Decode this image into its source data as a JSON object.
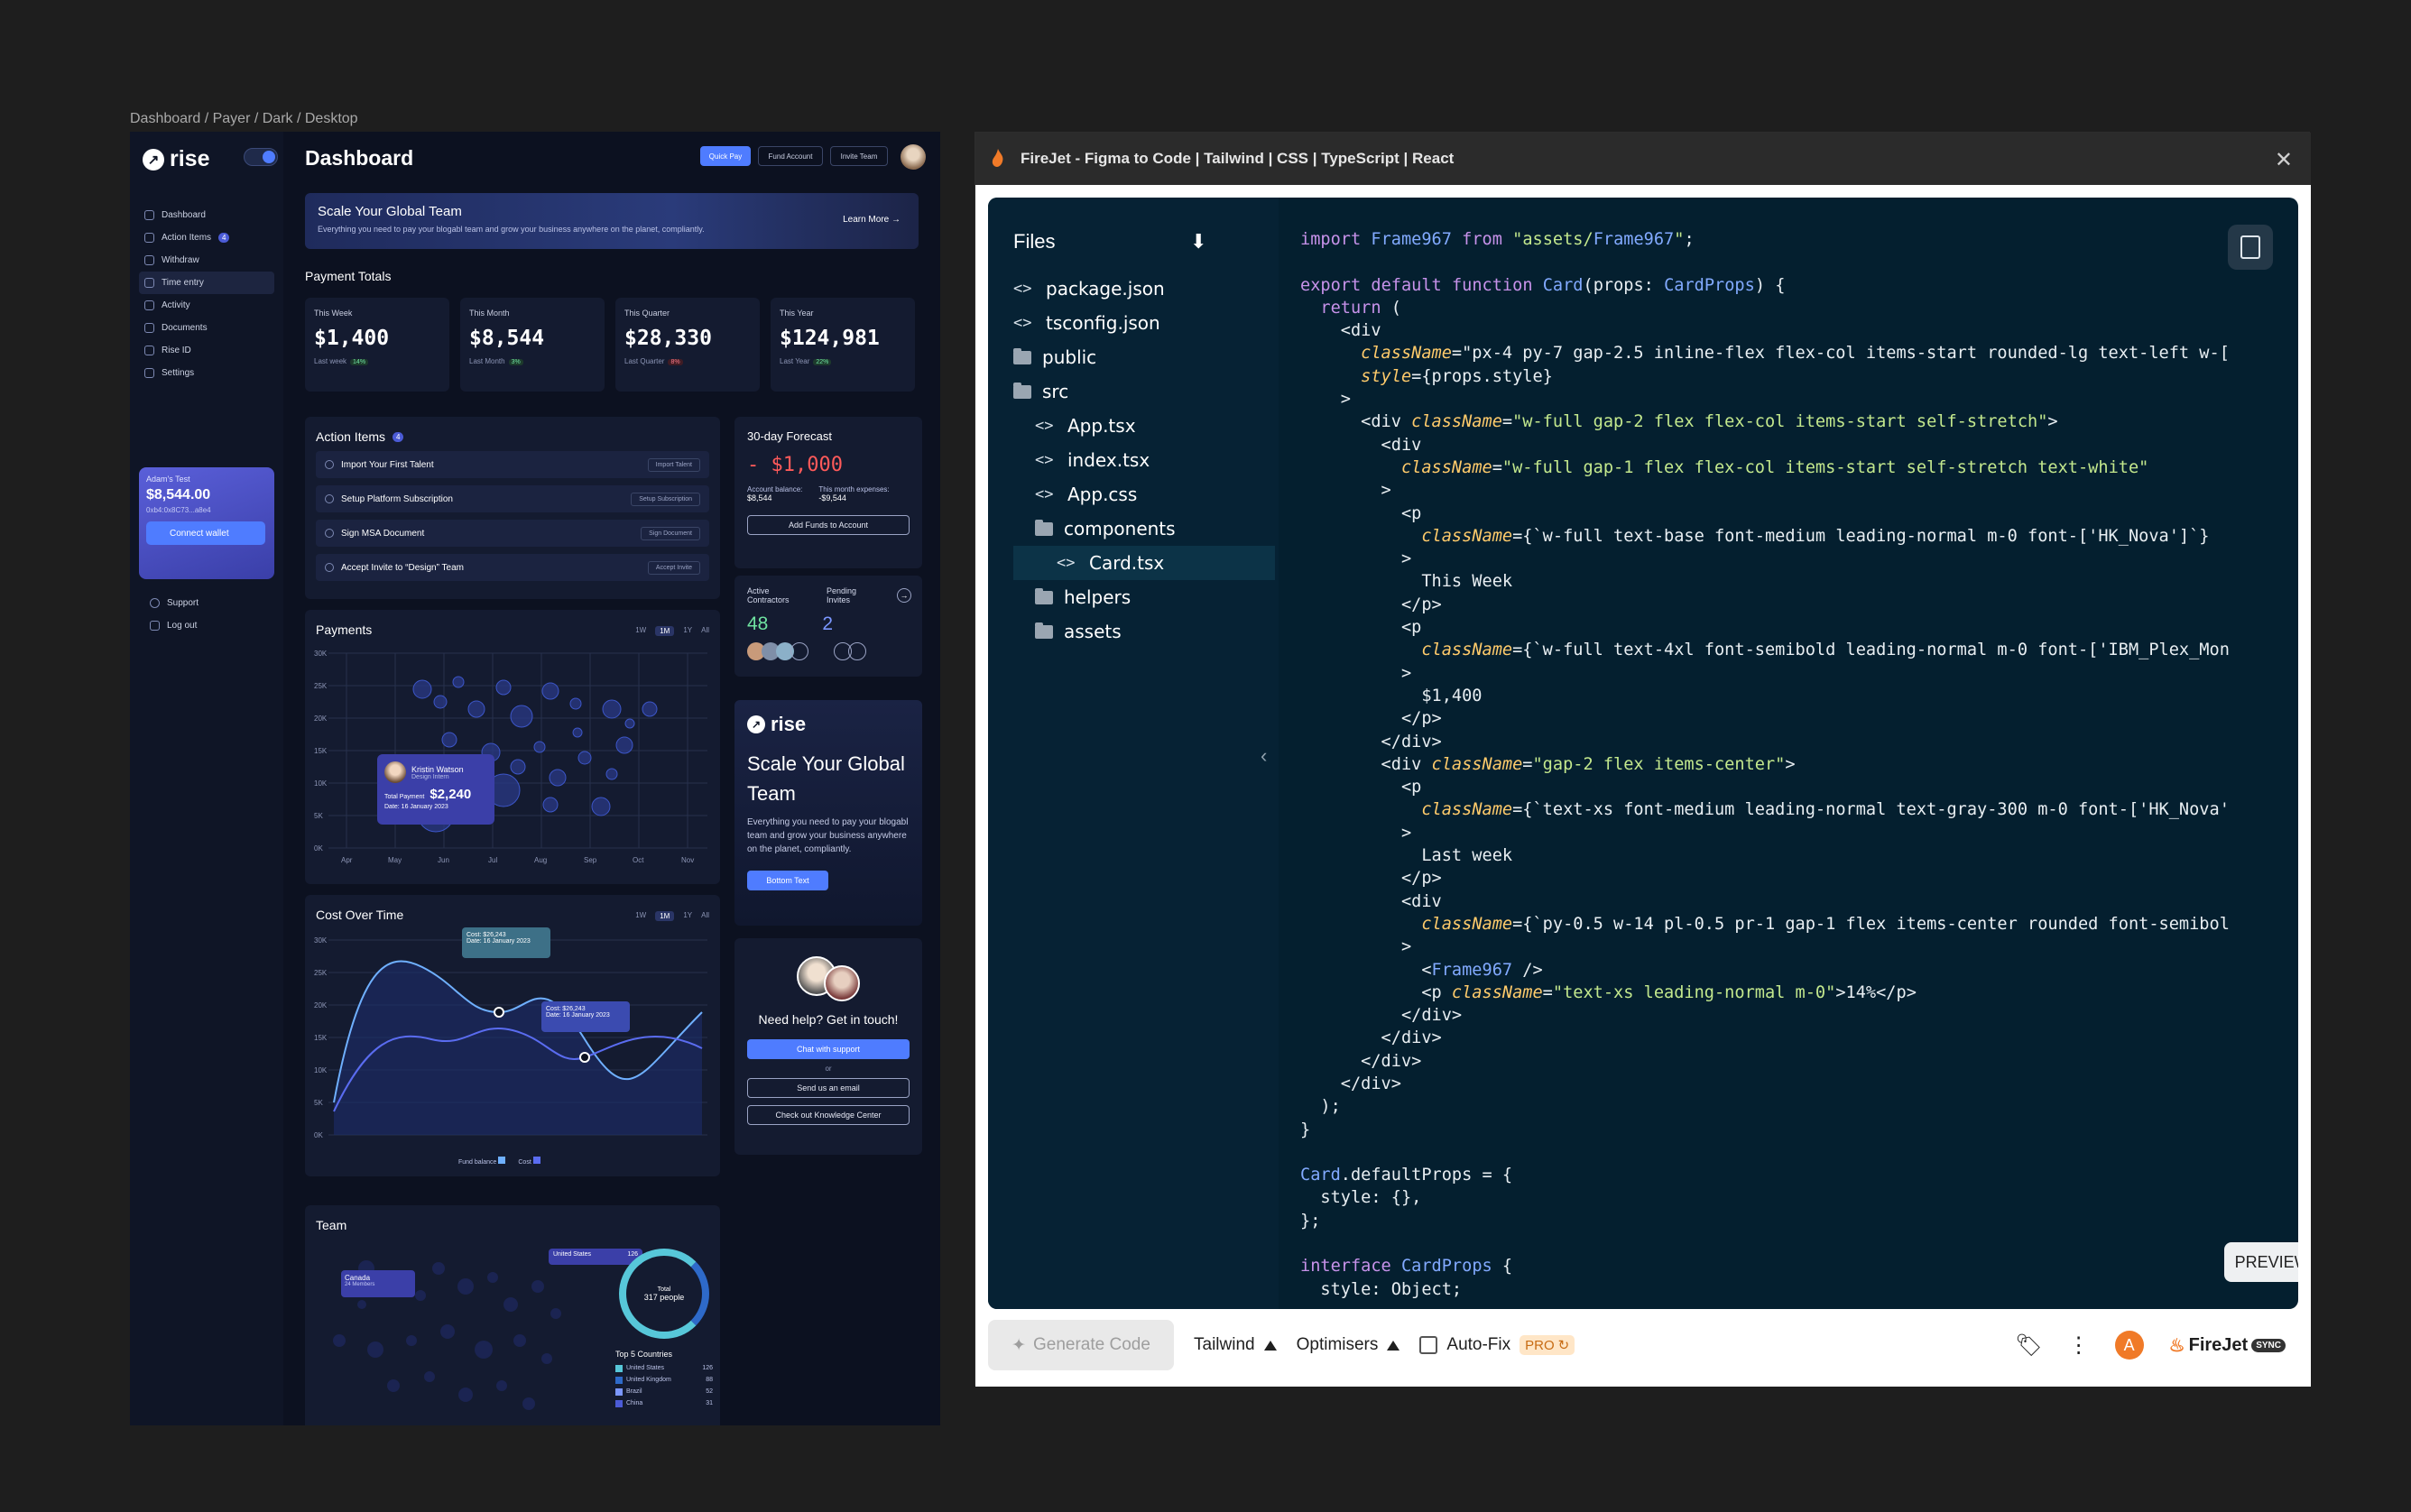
{
  "frame_label": "Dashboard / Payer / Dark / Desktop",
  "dashboard": {
    "brand": "rise",
    "title": "Dashboard",
    "header_buttons": {
      "quick_pay": "Quick Pay",
      "fund_account": "Fund Account",
      "invite_team": "Invite Team"
    },
    "nav": [
      {
        "label": "Dashboard"
      },
      {
        "label": "Action Items",
        "badge": "4"
      },
      {
        "label": "Withdraw"
      },
      {
        "label": "Time entry"
      },
      {
        "label": "Activity"
      },
      {
        "label": "Documents"
      },
      {
        "label": "Rise ID"
      },
      {
        "label": "Settings"
      }
    ],
    "wallet": {
      "label": "Adam's Test",
      "balance": "$8,544.00",
      "address": "0xb4:0x8C73...a8e4",
      "button": "Connect wallet"
    },
    "nav_bottom": {
      "support": "Support",
      "logout": "Log out"
    },
    "banner": {
      "title": "Scale Your Global Team",
      "subtitle": "Everything you need to pay your blogabl team and grow your business anywhere on the planet, compliantly.",
      "link": "Learn More"
    },
    "payment_totals": {
      "title": "Payment Totals",
      "cards": [
        {
          "label": "This Week",
          "value": "$1,400",
          "foot": "Last week",
          "delta": "14%"
        },
        {
          "label": "This Month",
          "value": "$8,544",
          "foot": "Last Month",
          "delta": "3%"
        },
        {
          "label": "This Quarter",
          "value": "$28,330",
          "foot": "Last Quarter",
          "delta": "8%"
        },
        {
          "label": "This Year",
          "value": "$124,981",
          "foot": "Last Year",
          "delta": "22%"
        }
      ]
    },
    "action_items": {
      "title": "Action Items",
      "count": "4",
      "rows": [
        {
          "label": "Import Your First Talent",
          "button": "Import Talent"
        },
        {
          "label": "Setup Platform Subscription",
          "button": "Setup Subscription"
        },
        {
          "label": "Sign MSA Document",
          "button": "Sign Document"
        },
        {
          "label": "Accept Invite to “Design” Team",
          "button": "Accept Invite"
        }
      ]
    },
    "forecast": {
      "title": "30-day Forecast",
      "value": "- $1,000",
      "balance_label": "Account balance:",
      "balance": "$8,544",
      "expenses_label": "This month expenses:",
      "expenses": "-$9,544",
      "button": "Add Funds to Account"
    },
    "contractors": {
      "active_label": "Active Contractors",
      "active": "48",
      "pending_label": "Pending Invites",
      "pending": "2"
    },
    "ad": {
      "brand": "rise",
      "title": "Scale Your Global Team",
      "text": "Everything you need to pay your blogabl team and grow your business anywhere on the planet, compliantly.",
      "button": "Bottom Text"
    },
    "help": {
      "title": "Need help? Get in touch!",
      "chat": "Chat with support",
      "or": "or",
      "email": "Send us an email",
      "kb": "Check out Knowledge Center"
    },
    "payments_chart": {
      "title": "Payments",
      "ranges": [
        "1W",
        "1M",
        "1Y",
        "All"
      ],
      "tooltip": {
        "name": "Kristin Watson",
        "role": "Design Intern",
        "label": "Total Payment",
        "amount": "$2,240",
        "date": "Date: 16 January 2023"
      }
    },
    "cost_chart": {
      "title": "Cost Over Time",
      "ranges": [
        "1W",
        "1M",
        "1Y",
        "All"
      ],
      "tip1": {
        "value": "Cost: $26,243",
        "date": "Date: 16 January 2023"
      },
      "tip2": {
        "value": "Cost: $26,243",
        "date": "Date: 16 January 2023"
      },
      "legend": [
        "Fund balance",
        "Cost"
      ]
    },
    "team": {
      "title": "Team",
      "canada": "Canada",
      "canada_sub": "24 Members",
      "us": "United States",
      "us_count": "126",
      "total_label": "Total",
      "total": "317 people",
      "top_title": "Top 5 Countries",
      "countries": [
        {
          "name": "United States",
          "n": "126"
        },
        {
          "name": "United Kingdom",
          "n": "88"
        },
        {
          "name": "Brazil",
          "n": "52"
        },
        {
          "name": "China",
          "n": "31"
        }
      ]
    }
  },
  "firejet": {
    "title": "FireJet - Figma to Code | Tailwind | CSS | TypeScript | React",
    "files_header": "Files",
    "files": [
      {
        "name": "package.json",
        "type": "file",
        "depth": 0
      },
      {
        "name": "tsconfig.json",
        "type": "file",
        "depth": 0
      },
      {
        "name": "public",
        "type": "folder",
        "depth": 0
      },
      {
        "name": "src",
        "type": "folder",
        "depth": 0
      },
      {
        "name": "App.tsx",
        "type": "file",
        "depth": 1
      },
      {
        "name": "index.tsx",
        "type": "file",
        "depth": 1
      },
      {
        "name": "App.css",
        "type": "file",
        "depth": 1
      },
      {
        "name": "components",
        "type": "folder",
        "depth": 1
      },
      {
        "name": "Card.tsx",
        "type": "file",
        "depth": 2,
        "selected": true
      },
      {
        "name": "helpers",
        "type": "folder",
        "depth": 1
      },
      {
        "name": "assets",
        "type": "folder",
        "depth": 1
      }
    ],
    "code_lines": [
      "import Frame967 from \"assets/Frame967\";",
      "",
      "export default function Card(props: CardProps) {",
      "  return (",
      "    <div",
      "      className=\"px-4 py-7 gap-2.5 inline-flex flex-col items-start rounded-lg text-left w-[",
      "      style={props.style}",
      "    >",
      "      <div className=\"w-full gap-2 flex flex-col items-start self-stretch\">",
      "        <div",
      "          className=\"w-full gap-1 flex flex-col items-start self-stretch text-white\"",
      "        >",
      "          <p",
      "            className={`w-full text-base font-medium leading-normal m-0 font-['HK_Nova']`}",
      "          >",
      "            This Week",
      "          </p>",
      "          <p",
      "            className={`w-full text-4xl font-semibold leading-normal m-0 font-['IBM_Plex_Mon",
      "          >",
      "            $1,400",
      "          </p>",
      "        </div>",
      "        <div className=\"gap-2 flex items-center\">",
      "          <p",
      "            className={`text-xs font-medium leading-normal text-gray-300 m-0 font-['HK_Nova'",
      "          >",
      "            Last week",
      "          </p>",
      "          <div",
      "            className={`py-0.5 w-14 pl-0.5 pr-1 gap-1 flex items-center rounded font-semibol",
      "          >",
      "            <Frame967 />",
      "            <p className=\"text-xs leading-normal m-0\">14%</p>",
      "          </div>",
      "        </div>",
      "      </div>",
      "    </div>",
      "  );",
      "}",
      "",
      "Card.defaultProps = {",
      "  style: {},",
      "};",
      "",
      "interface CardProps {",
      "  style: Object;"
    ],
    "preview_button": "PREVIEW",
    "toolbar": {
      "generate": "Generate Code",
      "framework": "Tailwind",
      "optimisers": "Optimisers",
      "autofix": "Auto-Fix",
      "pro": "PRO",
      "user_initial": "A",
      "brand": "FireJet",
      "sync": "SYNC"
    }
  }
}
